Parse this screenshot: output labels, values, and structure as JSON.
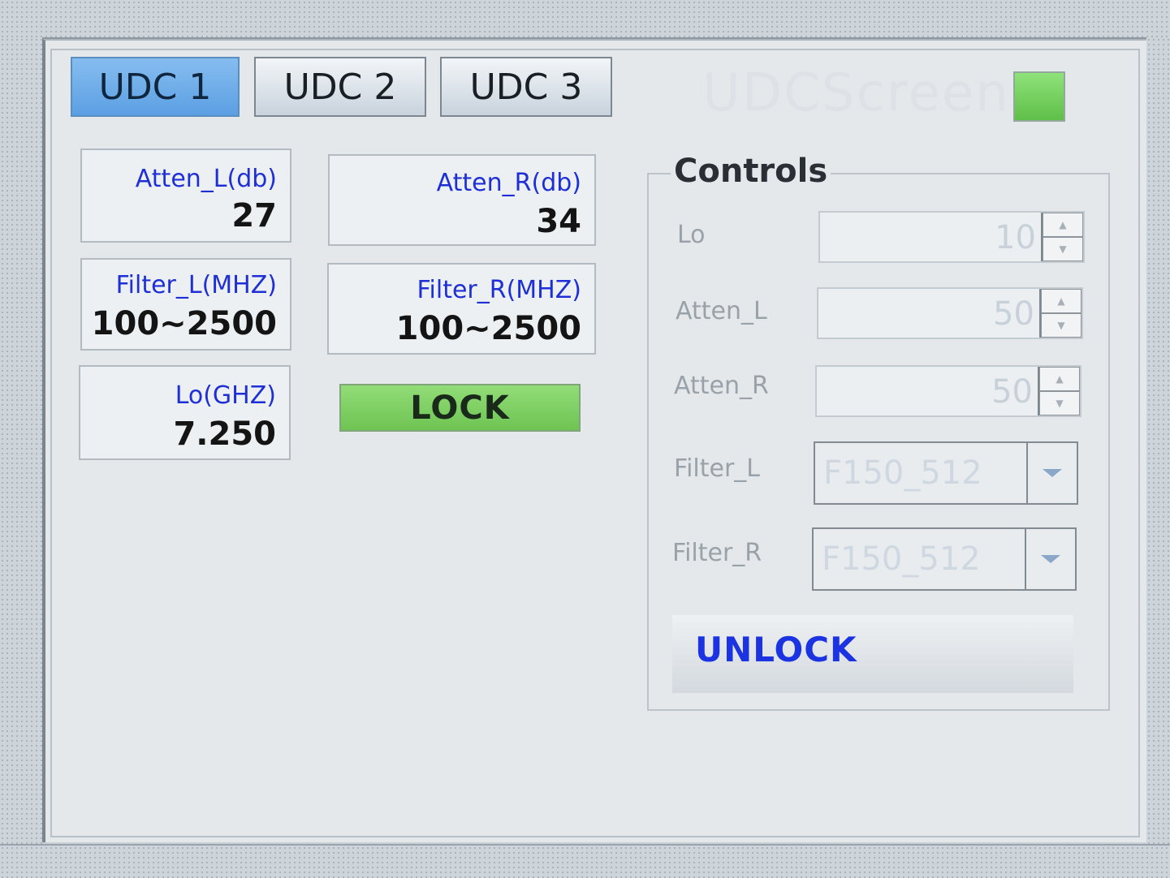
{
  "tabs": [
    {
      "label": "UDC 1",
      "active": true
    },
    {
      "label": "UDC 2",
      "active": false
    },
    {
      "label": "UDC 3",
      "active": false
    }
  ],
  "header": {
    "watermark": "UDCScreen",
    "status_color": "#6ec452"
  },
  "readouts": {
    "atten_l": {
      "label": "Atten_L(db)",
      "value": "27"
    },
    "atten_r": {
      "label": "Atten_R(db)",
      "value": "34"
    },
    "filter_l": {
      "label": "Filter_L(MHZ)",
      "value": "100~2500"
    },
    "filter_r": {
      "label": "Filter_R(MHZ)",
      "value": "100~2500"
    },
    "lo": {
      "label": "Lo(GHZ)",
      "value": "7.250"
    }
  },
  "lock_status": {
    "label": "LOCK",
    "color": "#6ec452"
  },
  "controls": {
    "title": "Controls",
    "lo": {
      "label": "Lo",
      "value": "10"
    },
    "atten_l": {
      "label": "Atten_L",
      "value": "50"
    },
    "atten_r": {
      "label": "Atten_R",
      "value": "50"
    },
    "filter_l": {
      "label": "Filter_L",
      "value": "F150_512"
    },
    "filter_r": {
      "label": "Filter_R",
      "value": "F150_512"
    },
    "unlock_label": "UNLOCK"
  },
  "colors": {
    "accent_tab": "#5b9fe3",
    "label_blue": "#1e2fd6"
  }
}
